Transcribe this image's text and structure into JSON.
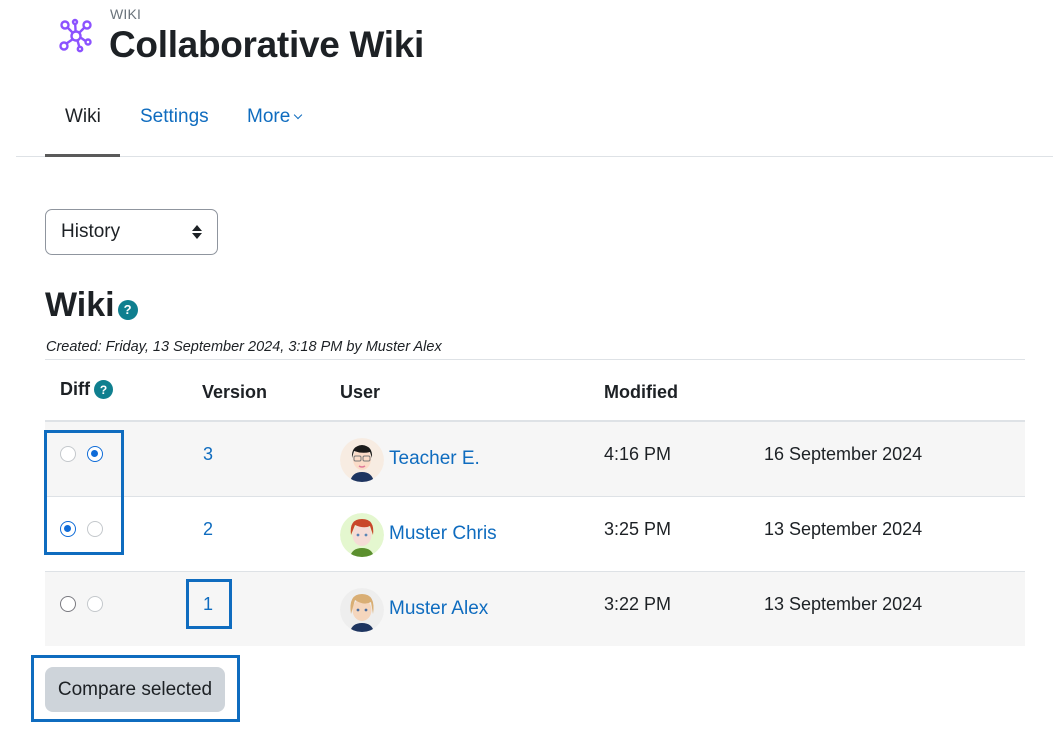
{
  "header": {
    "pretitle": "WIKI",
    "title": "Collaborative Wiki",
    "icon": "wiki-network-icon",
    "icon_color": "#8c52ff"
  },
  "nav": {
    "tabs": [
      {
        "label": "Wiki",
        "active": true
      },
      {
        "label": "Settings",
        "active": false
      },
      {
        "label": "More",
        "active": false,
        "has_dropdown": true
      }
    ]
  },
  "view_select": {
    "selected": "History"
  },
  "page": {
    "heading": "Wiki",
    "created": "Created: Friday, 13 September 2024, 3:18 PM by Muster Alex"
  },
  "table": {
    "headers": {
      "diff": "Diff",
      "version": "Version",
      "user": "User",
      "modified": "Modified"
    },
    "rows": [
      {
        "version": "3",
        "user": "Teacher E.",
        "time": "4:16 PM",
        "date": "16 September 2024",
        "radio_from": false,
        "radio_to": true
      },
      {
        "version": "2",
        "user": "Muster Chris",
        "time": "3:25 PM",
        "date": "13 September 2024",
        "radio_from": true,
        "radio_to": false
      },
      {
        "version": "1",
        "user": "Muster Alex",
        "time": "3:22 PM",
        "date": "13 September 2024",
        "radio_from": false,
        "radio_to": false
      }
    ]
  },
  "actions": {
    "compare_label": "Compare selected"
  },
  "colors": {
    "link": "#0f6cbf",
    "help": "#0f7f8f",
    "highlight": "#0f6cbf",
    "radio_checked": "#0f6cd8"
  },
  "help_glyph": "?"
}
